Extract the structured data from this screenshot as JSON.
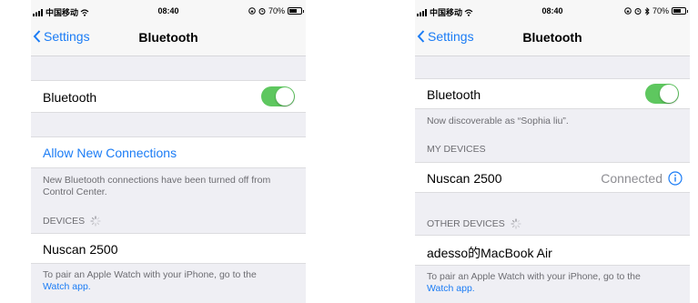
{
  "screens": [
    {
      "status": {
        "carrier": "中国移动",
        "time": "08:40",
        "battery": "70%",
        "battery_level": 0.7
      },
      "nav": {
        "back_label": "Settings",
        "title": "Bluetooth"
      },
      "bluetooth_row": {
        "label": "Bluetooth",
        "enabled": true
      },
      "allow_new_connections": "Allow New Connections",
      "info_text": "New Bluetooth connections have been turned off from Control Center.",
      "devices_header": "DEVICES",
      "device": "Nuscan 2500",
      "footer": {
        "text": "To pair an Apple Watch with your iPhone, go to the",
        "link": "Watch app."
      }
    },
    {
      "status": {
        "carrier": "中国移动",
        "time": "08:40",
        "battery": "70%",
        "battery_level": 0.7
      },
      "nav": {
        "back_label": "Settings",
        "title": "Bluetooth"
      },
      "bluetooth_row": {
        "label": "Bluetooth",
        "enabled": true
      },
      "discoverable_text": "Now discoverable as “Sophia liu”.",
      "my_devices_header": "MY DEVICES",
      "my_device": {
        "name": "Nuscan 2500",
        "status": "Connected"
      },
      "other_devices_header": "OTHER DEVICES",
      "other_device": "adesso的MacBook Air",
      "footer": {
        "text": "To pair an Apple Watch with your iPhone, go to the",
        "link": "Watch app."
      }
    }
  ],
  "colors": {
    "accent": "#1b7cf5",
    "toggle_on": "#5ec75f",
    "background": "#efeff4",
    "secondary_text": "#6d6d72"
  }
}
